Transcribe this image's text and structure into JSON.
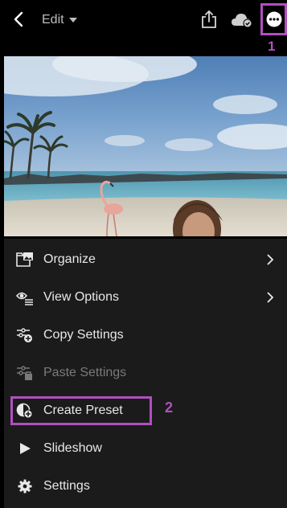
{
  "topbar": {
    "edit_label": "Edit",
    "icons": [
      "back-icon",
      "caret-down-icon",
      "share-icon",
      "cloud-sync-icon",
      "more-icon"
    ]
  },
  "annotations": {
    "step1": "1",
    "step2": "2",
    "color": "#b14fc0"
  },
  "menu": {
    "items": [
      {
        "label": "Organize",
        "icon": "organize-icon",
        "has_submenu": true,
        "enabled": true
      },
      {
        "label": "View Options",
        "icon": "view-options-icon",
        "has_submenu": true,
        "enabled": true
      },
      {
        "label": "Copy Settings",
        "icon": "copy-settings-icon",
        "has_submenu": false,
        "enabled": true
      },
      {
        "label": "Paste Settings",
        "icon": "paste-settings-icon",
        "has_submenu": false,
        "enabled": false
      },
      {
        "label": "Create Preset",
        "icon": "create-preset-icon",
        "has_submenu": false,
        "enabled": true
      },
      {
        "label": "Slideshow",
        "icon": "play-icon",
        "has_submenu": false,
        "enabled": true
      },
      {
        "label": "Settings",
        "icon": "gear-icon",
        "has_submenu": false,
        "enabled": true
      }
    ]
  },
  "colors": {
    "menu_bg": "#1b1b1b",
    "text": "#e8e8e8",
    "disabled_text": "#7a7a7a",
    "accent": "#b14fc0"
  }
}
